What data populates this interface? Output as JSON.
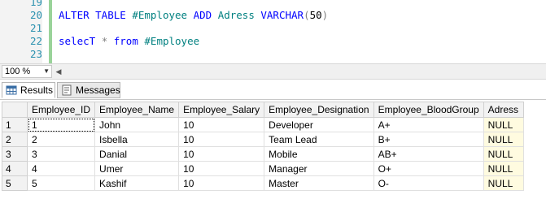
{
  "editor": {
    "lines": [
      {
        "num": "19",
        "tokens": []
      },
      {
        "num": "20",
        "tokens": [
          {
            "t": "ALTER TABLE ",
            "c": "kw"
          },
          {
            "t": "#Employee",
            "c": "id"
          },
          {
            "t": " ADD ",
            "c": "kw"
          },
          {
            "t": "Adress",
            "c": "id"
          },
          {
            "t": " VARCHAR",
            "c": "kw"
          },
          {
            "t": "(",
            "c": "op"
          },
          {
            "t": "50",
            "c": "plain"
          },
          {
            "t": ")",
            "c": "op"
          }
        ]
      },
      {
        "num": "21",
        "tokens": []
      },
      {
        "num": "22",
        "tokens": [
          {
            "t": "selecT ",
            "c": "kw"
          },
          {
            "t": "* ",
            "c": "op"
          },
          {
            "t": "from ",
            "c": "kw"
          },
          {
            "t": "#Employee",
            "c": "id"
          }
        ]
      },
      {
        "num": "23",
        "tokens": []
      }
    ]
  },
  "zoom": {
    "value": "100 %"
  },
  "tabs": [
    {
      "label": "Results",
      "active": true,
      "icon": "grid-icon"
    },
    {
      "label": "Messages",
      "active": false,
      "icon": "messages-icon"
    }
  ],
  "grid": {
    "columns": [
      "Employee_ID",
      "Employee_Name",
      "Employee_Salary",
      "Employee_Designation",
      "Employee_BloodGroup",
      "Adress"
    ],
    "rows": [
      {
        "n": "1",
        "cells": [
          "1",
          "John",
          "10",
          "Developer",
          "A+",
          "NULL"
        ]
      },
      {
        "n": "2",
        "cells": [
          "2",
          "Isbella",
          "10",
          "Team Lead",
          "B+",
          "NULL"
        ]
      },
      {
        "n": "3",
        "cells": [
          "3",
          "Danial",
          "10",
          "Mobile",
          "AB+",
          "NULL"
        ]
      },
      {
        "n": "4",
        "cells": [
          "4",
          "Umer",
          "10",
          "Manager",
          "O+",
          "NULL"
        ]
      },
      {
        "n": "5",
        "cells": [
          "5",
          "Kashif",
          "10",
          "Master",
          "O-",
          "NULL"
        ]
      }
    ]
  },
  "colors": {
    "keyword": "#0000ff",
    "identifier": "#008080",
    "operator": "#808080",
    "line_number": "#2b91af",
    "null_bg": "#fffbe0"
  }
}
